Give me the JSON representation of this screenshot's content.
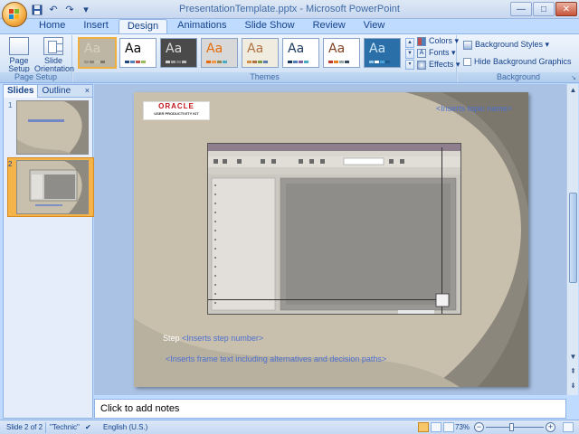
{
  "window": {
    "title": "PresentationTemplate.pptx - Microsoft PowerPoint"
  },
  "qat": {
    "icons": [
      "save-icon",
      "undo-icon",
      "redo-icon",
      "customize-icon"
    ]
  },
  "tabs": [
    {
      "label": "Home"
    },
    {
      "label": "Insert"
    },
    {
      "label": "Design",
      "active": true
    },
    {
      "label": "Animations"
    },
    {
      "label": "Slide Show"
    },
    {
      "label": "Review"
    },
    {
      "label": "View"
    }
  ],
  "ribbon": {
    "page_setup": {
      "label": "Page Setup",
      "page_setup_btn": "Page Setup",
      "orientation_btn": "Slide Orientation ▾"
    },
    "themes": {
      "label": "Themes",
      "items": [
        {
          "text": "Aa",
          "bg": "#bdb6a4",
          "fg": "#d7d0bf",
          "bars": [
            "#9f978a",
            "#8e8678",
            "#c5bfb2",
            "#7e776c"
          ],
          "selected": true
        },
        {
          "text": "Aa",
          "bg": "#ffffff",
          "fg": "#000000",
          "bars": [
            "#1f497d",
            "#4f81bd",
            "#c0504d",
            "#9bbb59"
          ]
        },
        {
          "text": "Aa",
          "bg": "#4a4a4a",
          "fg": "#dcdcdc",
          "bars": [
            "#d0d0d0",
            "#a0a0a0",
            "#7a7a7a",
            "#bbbbbb"
          ]
        },
        {
          "text": "Aa",
          "bg": "#d8d8d8",
          "fg": "#e46c0a",
          "bars": [
            "#e46c0a",
            "#f79646",
            "#948a54",
            "#4bacc6"
          ]
        },
        {
          "text": "Aa",
          "bg": "#f0ece0",
          "fg": "#b07040",
          "bars": [
            "#d19049",
            "#b07040",
            "#7a9a4a",
            "#5a7ab0"
          ]
        },
        {
          "text": "Aa",
          "bg": "#ffffff",
          "fg": "#17375e",
          "bars": [
            "#17375e",
            "#4f81bd",
            "#8064a2",
            "#4bacc6"
          ]
        },
        {
          "text": "Aa",
          "bg": "#ffffff",
          "fg": "#7f3f1f",
          "bars": [
            "#c0392b",
            "#e67e22",
            "#95a5a6",
            "#34495e"
          ]
        },
        {
          "text": "Aa",
          "bg": "#2a6fa8",
          "fg": "#d0e6f7",
          "bars": [
            "#8fc7ee",
            "#ffffff",
            "#4aa0d8",
            "#1c5b8e"
          ]
        }
      ]
    },
    "colors_btn": "Colors ▾",
    "fonts_btn": "Fonts ▾",
    "effects_btn": "Effects ▾",
    "background": {
      "label": "Background",
      "styles_btn": "Background Styles ▾",
      "hide_graphics": "Hide Background Graphics"
    }
  },
  "left_pane": {
    "tab_slides": "Slides",
    "tab_outline": "Outline",
    "close": "×",
    "slides": [
      {
        "num": "1"
      },
      {
        "num": "2",
        "selected": true
      }
    ]
  },
  "slide": {
    "logo_main": "ORACLE",
    "logo_sub": "USER PRODUCTIVITY KIT",
    "topic": "<Inserts topic name>",
    "step_label": "Step",
    "step_number": "<Inserts step number>",
    "frame_text": "<Inserts frame text including alternatives and decision paths>"
  },
  "notes": {
    "placeholder": "Click to add notes"
  },
  "status": {
    "slide_pos": "Slide 2 of 2",
    "theme": "\"Technic\"",
    "language": "English (U.S.)",
    "zoom": "73%",
    "zoom_fraction": 0.45
  }
}
